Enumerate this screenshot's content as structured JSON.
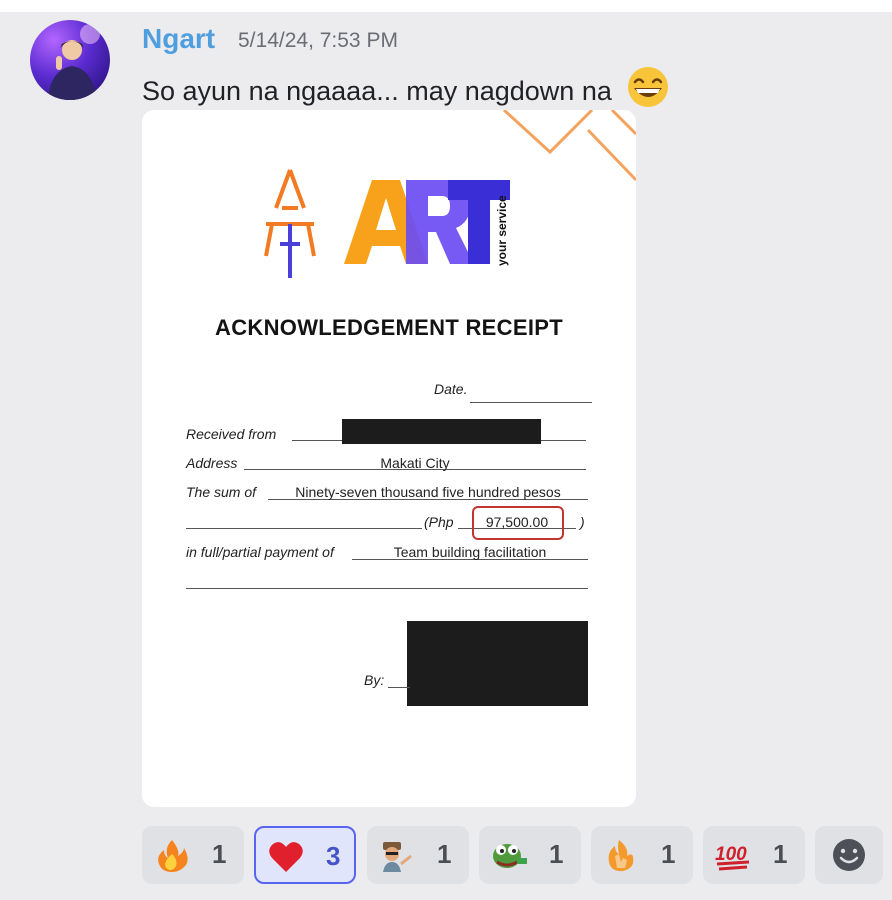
{
  "message": {
    "username": "Ngart",
    "timestamp": "5/14/24, 7:53 PM",
    "text": "So ayun na ngaaaa... may nagdown na",
    "text_emoji": "grinning-face-with-smiling-eyes"
  },
  "receipt": {
    "logo_text": "ART",
    "logo_tagline": "your service",
    "title": "ACKNOWLEDGEMENT RECEIPT",
    "date_label": "Date.",
    "received_from_label": "Received from",
    "address_label": "Address",
    "address_value": "Makati City",
    "sum_label": "The sum of",
    "sum_value": "Ninety-seven thousand five hundred pesos",
    "php_label": "(Php",
    "php_value": "97,500.00",
    "php_close": ")",
    "payment_label": "in full/partial payment of",
    "payment_value": "Team building facilitation",
    "by_label": "By:"
  },
  "reactions": [
    {
      "emoji": "fire",
      "count": "1",
      "active": false
    },
    {
      "emoji": "red-heart",
      "count": "3",
      "active": true
    },
    {
      "emoji": "custom-man-pointing",
      "count": "1",
      "active": false
    },
    {
      "emoji": "custom-pepe-frog",
      "count": "1",
      "active": false
    },
    {
      "emoji": "custom-fire-hand",
      "count": "1",
      "active": false
    },
    {
      "emoji": "hundred-points",
      "count": "1",
      "active": false
    }
  ],
  "add_reaction_icon": "add-reaction-icon",
  "colors": {
    "username": "#4f9fe0",
    "active_reaction_border": "#5865f2",
    "highlight_box": "#c0352f"
  }
}
